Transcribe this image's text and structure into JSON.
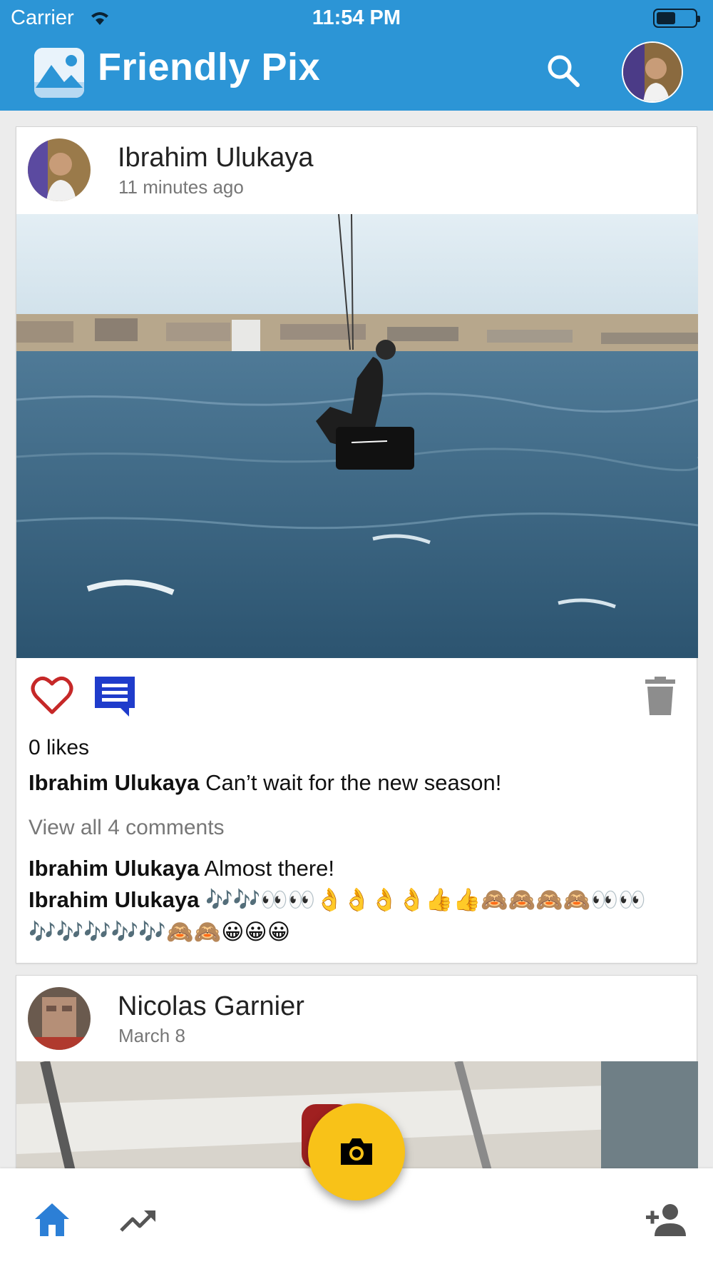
{
  "status_bar": {
    "carrier": "Carrier",
    "time": "11:54 PM"
  },
  "header": {
    "title": "Friendly Pix",
    "icons": [
      "logo-icon",
      "search-icon",
      "avatar"
    ]
  },
  "posts": [
    {
      "author": "Ibrahim Ulukaya",
      "time": "11 minutes ago",
      "likes": "0 likes",
      "caption_author": "Ibrahim Ulukaya",
      "caption_text": "Can’t wait for the new season!",
      "view_all": "View all 4 comments",
      "comments": [
        {
          "author": "Ibrahim Ulukaya",
          "text": "Almost there!"
        },
        {
          "author": "Ibrahim Ulukaya",
          "text": "🎶🎶👀👀👌👌👌👌👍👍🙈🙈🙈🙈👀👀🎶🎶🎶🎶🎶🙈🙈😀😀😀"
        }
      ]
    },
    {
      "author": "Nicolas Garnier",
      "time": "March 8"
    }
  ],
  "bottom_nav": {
    "icons": [
      "home-icon",
      "trending-icon",
      "camera-icon",
      "add-user-icon"
    ]
  },
  "colors": {
    "header": "#2c95d6",
    "like": "#c62828",
    "comment": "#1f3ccb",
    "fab": "#f8c218",
    "home": "#2c7fd6"
  }
}
